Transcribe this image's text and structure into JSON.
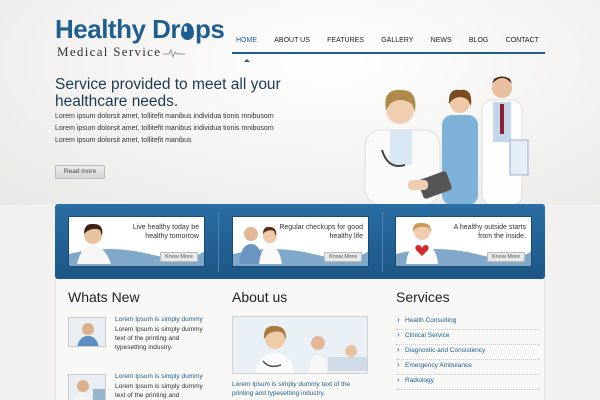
{
  "brand": {
    "logo_part1": "Healthy Dr",
    "logo_part2": "ps",
    "tagline": "Medical Service",
    "color": "#1f5f8f"
  },
  "nav": {
    "items": [
      "HOME",
      "ABOUT US",
      "FEATURES",
      "GALLERY",
      "NEWS",
      "BLOG",
      "CONTACT"
    ],
    "active": "HOME"
  },
  "hero": {
    "title": "Service provided to meet all your healthcare needs.",
    "text": "Lorem ipsum dolorsit amet, tollitefit manibus individua tionis mnibusom Lorem ipsum dolorsit amet, tollitefit manibus individua tionis mnibusom Lorem ipsum dolorsit amet, tollitefit manibus",
    "button": "Read more"
  },
  "features": [
    {
      "text": "Live healthy today be healthy tomorrow",
      "button": "Know More"
    },
    {
      "text": "Regular checkups for good healthy life",
      "button": "Know More"
    },
    {
      "text": "A healthy outside starts from the inside.",
      "button": "Know More"
    }
  ],
  "whats_new": {
    "title": "Whats New",
    "items": [
      {
        "title": "Lorem Ipsum is simply dummy",
        "text": "Lorem Ipsum is simply dummy text of the printing and typesetting industry."
      },
      {
        "title": "Lorem Ipsum is simply dummy",
        "text": "Lorem Ipsum is simply dummy text of the printing and typesetting"
      }
    ]
  },
  "about": {
    "title": "About us",
    "text": "Lorem Ipsum is simply dummy text of the printing and typesetting industry."
  },
  "services": {
    "title": "Services",
    "items": [
      "Health Consulting",
      "Clinical Service",
      "Diagnostic and Consistency",
      "Emergency Ambulance",
      "Radiology"
    ]
  },
  "colors": {
    "primary": "#1f5f8f",
    "banner": "#2b6ea3",
    "text": "#333333"
  }
}
